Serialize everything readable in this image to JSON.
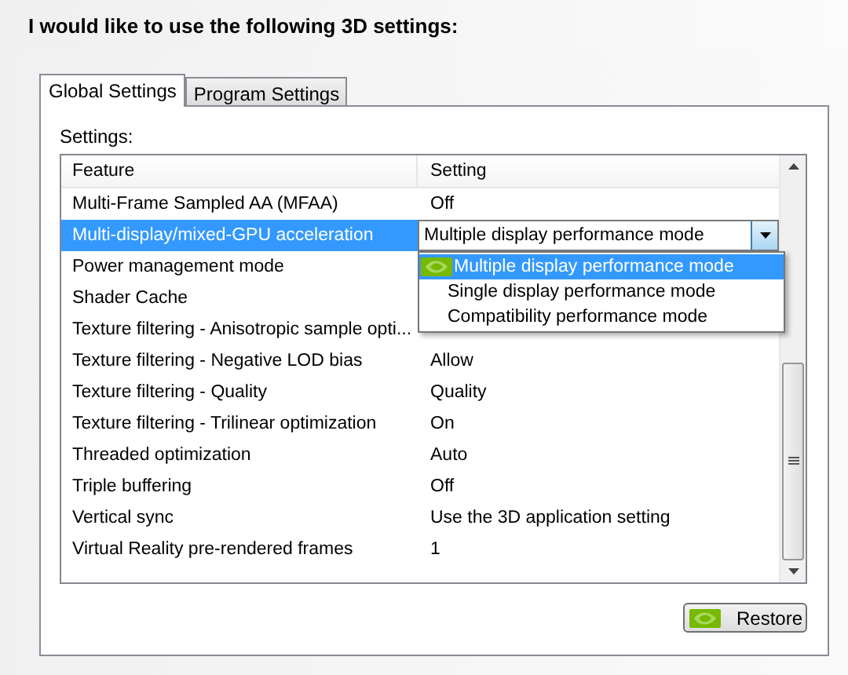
{
  "heading": "I would like to use the following 3D settings:",
  "tabs": [
    {
      "label": "Global Settings",
      "selected": true
    },
    {
      "label": "Program Settings",
      "selected": false
    }
  ],
  "settings_label": "Settings:",
  "table": {
    "columns": [
      "Feature",
      "Setting"
    ],
    "rows": [
      {
        "feature": "Multi-Frame Sampled AA (MFAA)",
        "setting": "Off",
        "selected": false
      },
      {
        "feature": "Multi-display/mixed-GPU acceleration",
        "selected": true,
        "dropdown": {
          "value": "Multiple display performance mode",
          "options": [
            {
              "label": "Multiple display performance mode",
              "selected": true
            },
            {
              "label": "Single display performance mode",
              "selected": false
            },
            {
              "label": "Compatibility performance mode",
              "selected": false
            }
          ]
        }
      },
      {
        "feature": "Power management mode",
        "selected": false
      },
      {
        "feature": "Shader Cache",
        "selected": false
      },
      {
        "feature": "Texture filtering - Anisotropic sample opti...",
        "selected": false
      },
      {
        "feature": "Texture filtering - Negative LOD bias",
        "setting": "Allow",
        "selected": false
      },
      {
        "feature": "Texture filtering - Quality",
        "setting": "Quality",
        "selected": false
      },
      {
        "feature": "Texture filtering - Trilinear optimization",
        "setting": "On",
        "selected": false
      },
      {
        "feature": "Threaded optimization",
        "setting": "Auto",
        "selected": false
      },
      {
        "feature": "Triple buffering",
        "setting": "Off",
        "selected": false
      },
      {
        "feature": "Vertical sync",
        "setting": "Use the 3D application setting",
        "selected": false
      },
      {
        "feature": "Virtual Reality pre-rendered frames",
        "setting": "1",
        "selected": false
      }
    ]
  },
  "restore_button": "Restore"
}
